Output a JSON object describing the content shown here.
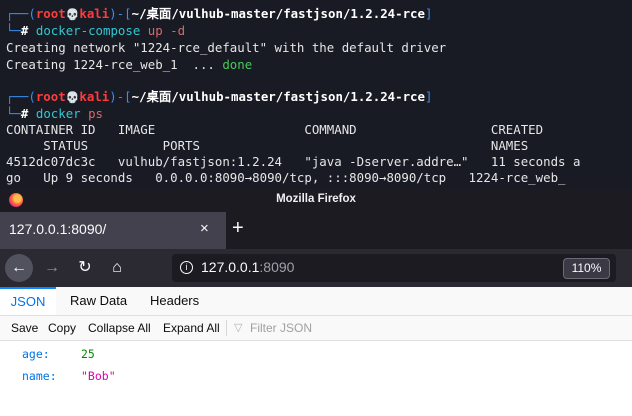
{
  "terminal": {
    "prompt_user": "root",
    "prompt_host": "kali",
    "prompt_path": "~/桌面/vulhub-master/fastjson/1.2.24-rce",
    "prompt_symbol": "#",
    "cmd1_bin": "docker-compose",
    "cmd1_args": "up -d",
    "out1": "Creating network \"1224-rce_default\" with the default driver",
    "out2_prefix": "Creating 1224-rce_web_1  ... ",
    "out2_status": "done",
    "cmd2_bin": "docker",
    "cmd2_args": "ps",
    "ps_header1": "CONTAINER ID   IMAGE                    COMMAND                  CREATED",
    "ps_header2": "     STATUS          PORTS                                       NAMES",
    "ps_row1": "4512dc07dc3c   vulhub/fastjson:1.2.24   \"java -Dserver.addre…\"   11 seconds a",
    "ps_row2": "go   Up 9 seconds   0.0.0.0:8090→8090/tcp, :::8090→8090/tcp   1224-rce_web_"
  },
  "firefox": {
    "window_title": "Mozilla Firefox",
    "tab_title": "127.0.0.1:8090/",
    "tab_close": "×",
    "new_tab": "+",
    "back": "←",
    "forward": "→",
    "reload": "↻",
    "home": "⌂",
    "url_host": "127.0.0.1",
    "url_port": ":8090",
    "zoom": "110%"
  },
  "json_viewer": {
    "tabs": [
      "JSON",
      "Raw Data",
      "Headers"
    ],
    "toolbar": {
      "save": "Save",
      "copy": "Copy",
      "collapse_all": "Collapse All",
      "expand_all": "Expand All",
      "filter_placeholder": "Filter JSON"
    },
    "rows": [
      {
        "key": "age:",
        "value": "25"
      },
      {
        "key": "name:",
        "value": "\"Bob\""
      }
    ]
  },
  "colors": {
    "terminal_bg": "#181b24",
    "prompt_blue": "#3b8eea",
    "prompt_red": "#ff3c3c",
    "json_key": "#0074e8",
    "json_number": "#058b00",
    "json_string": "#dd00a9"
  }
}
